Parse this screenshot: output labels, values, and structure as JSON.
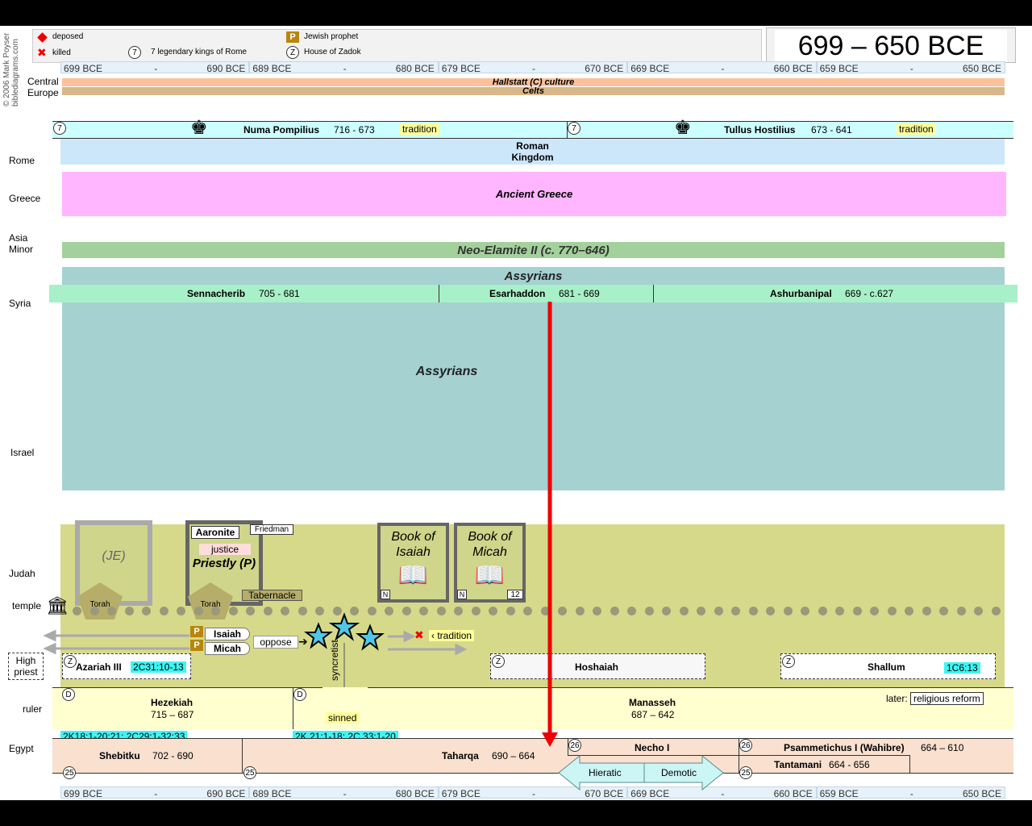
{
  "title": "699 – 650 BCE",
  "copyright": "© 2006 Mark Poyser",
  "site": "biblediagrams.com",
  "legend": {
    "deposed": "deposed",
    "killed": "killed",
    "kings_rome_num": "7",
    "kings_rome": "7 legendary kings of Rome",
    "prophet_tag": "P",
    "prophet": "Jewish prophet",
    "zadok_tag": "Z",
    "zadok": "House of Zadok"
  },
  "axis": [
    [
      "699 BCE",
      "-",
      "690 BCE"
    ],
    [
      "689 BCE",
      "-",
      "680 BCE"
    ],
    [
      "679 BCE",
      "-",
      "670 BCE"
    ],
    [
      "669 BCE",
      "-",
      "660 BCE"
    ],
    [
      "659 BCE",
      "-",
      "650 BCE"
    ]
  ],
  "rows": {
    "central_europe": "Central Europe",
    "rome": "Rome",
    "greece": "Greece",
    "asia_minor": "Asia Minor",
    "syria": "Syria",
    "israel": "Israel",
    "judah": "Judah",
    "temple": "temple",
    "high_priest": "High priest",
    "ruler": "ruler",
    "egypt": "Egypt"
  },
  "central_europe": {
    "hallstatt": "Hallstatt (C) culture",
    "celts": "Celts"
  },
  "rome": {
    "kings": [
      {
        "num": "7",
        "name": "Numa Pompilius",
        "years": "716 - 673",
        "tag": "tradition"
      },
      {
        "num": "7",
        "name": "Tullus Hostilius",
        "years": "673 - 641",
        "tag": "tradition"
      }
    ],
    "kingdom": "Roman Kingdom"
  },
  "greece": "Ancient Greece",
  "asia_minor": "Neo-Elamite II (c. 770–646)",
  "syria": {
    "band": "Assyrians",
    "kings": [
      {
        "name": "Sennacherib",
        "years": "705 - 681"
      },
      {
        "name": "Esarhaddon",
        "years": "681 - 669"
      },
      {
        "name": "Ashurbanipal",
        "years": "669 - c.627"
      }
    ]
  },
  "israel": "Assyrians",
  "judah": {
    "je": "(JE)",
    "torah": "Torah",
    "aaronite": "Aaronite",
    "friedman": "Friedman",
    "justice": "justice",
    "priestly": "Priestly (P)",
    "tabernacle": "Tabernacle",
    "isaiah_book": "Book of Isaiah",
    "micah_book": "Book of Micah",
    "n": "N",
    "micah_num": "12",
    "prophet_tag": "P",
    "isaiah": "Isaiah",
    "micah": "Micah",
    "oppose": "oppose",
    "syncretist": "syncretist",
    "tradition": "tradition",
    "sinned": "sinned"
  },
  "high_priests": [
    {
      "tag": "Z",
      "name": "Azariah III",
      "ref": "2C31:10-13"
    },
    {
      "tag": "Z",
      "name": "Hoshaiah",
      "ref": ""
    },
    {
      "tag": "Z",
      "name": "Shallum",
      "ref": "1C6:13"
    }
  ],
  "rulers": {
    "hezekiah": {
      "tag": "D",
      "name": "Hezekiah",
      "years": "715 – 687",
      "ref": "2K18:1-20:21;  2C29:1-32:33"
    },
    "manasseh": {
      "tag": "D",
      "name": "Manasseh",
      "years": "687 – 642",
      "ref": "2K 21:1-18;  2C 33:1-20"
    },
    "later": "later:",
    "reform": "religious reform"
  },
  "egypt": {
    "dyn25": "25",
    "dyn26": "26",
    "shebitku": {
      "name": "Shebitku",
      "years": "702 - 690"
    },
    "taharqa": {
      "name": "Taharqa",
      "years": "690 – 664"
    },
    "necho": "Necho I",
    "psammetichus": {
      "name": "Psammetichus I (Wahibre)",
      "years": "664 – 610"
    },
    "tantamani": {
      "name": "Tantamani",
      "years": "664 - 656"
    },
    "hieratic": "Hieratic",
    "demotic": "Demotic"
  },
  "colors": {
    "rome_kings": "#ccffff",
    "rome_kingdom": "#cce6fa",
    "greece": "#ffb6ff",
    "elamite": "#a3d19b",
    "assyria": "#a5d1d1",
    "syria_kings": "#a8f0c8",
    "judah": "#d6d98a",
    "ruler": "#ffffd0",
    "egypt": "#f9e0cf",
    "marker": "#ee0000"
  }
}
